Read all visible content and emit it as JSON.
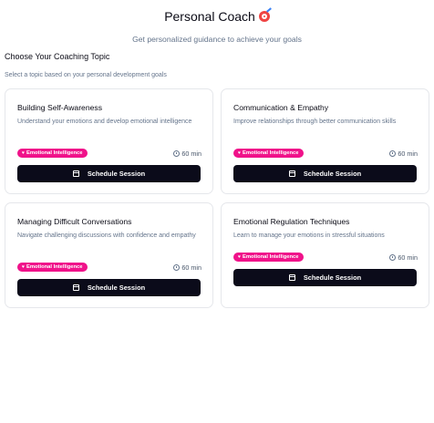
{
  "header": {
    "title": "Personal Coach",
    "title_emoji": "dart-target-emoji",
    "subtitle": "Get personalized guidance to achieve your goals"
  },
  "section": {
    "title": "Choose Your Coaching Topic",
    "subtitle": "Select a topic based on your personal development goals"
  },
  "cards": [
    {
      "title": "Building Self-Awareness",
      "description": "Understand your emotions and develop emotional intelligence",
      "badge": "Emotional Intelligence",
      "duration": "60 min",
      "button": "Schedule Session"
    },
    {
      "title": "Communication & Empathy",
      "description": "Improve relationships through better communication skills",
      "badge": "Emotional Intelligence",
      "duration": "60 min",
      "button": "Schedule Session"
    },
    {
      "title": "Managing Difficult Conversations",
      "description": "Navigate challenging discussions with confidence and empathy",
      "badge": "Emotional Intelligence",
      "duration": "60 min",
      "button": "Schedule Session"
    },
    {
      "title": "Emotional Regulation Techniques",
      "description": "Learn to manage your emotions in stressful situations",
      "badge": "Emotional Intelligence",
      "duration": "60 min",
      "button": "Schedule Session"
    }
  ],
  "colors": {
    "badge": "#f0128a",
    "button": "#0b0b1a",
    "muted_text": "#64748b"
  }
}
